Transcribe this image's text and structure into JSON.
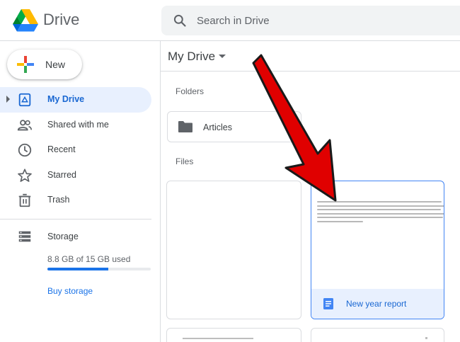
{
  "header": {
    "app_name": "Drive",
    "search_placeholder": "Search in Drive"
  },
  "sidebar": {
    "new_label": "New",
    "items": [
      {
        "label": "My Drive",
        "icon": "my-drive-icon",
        "active": true
      },
      {
        "label": "Shared with me",
        "icon": "shared-people-icon",
        "active": false
      },
      {
        "label": "Recent",
        "icon": "clock-icon",
        "active": false
      },
      {
        "label": "Starred",
        "icon": "star-icon",
        "active": false
      },
      {
        "label": "Trash",
        "icon": "trash-icon",
        "active": false
      }
    ],
    "storage": {
      "label": "Storage",
      "used_text": "8.8 GB of 15 GB used",
      "used_fraction": 0.587,
      "buy_label": "Buy storage"
    }
  },
  "main": {
    "title": "My Drive",
    "folders_label": "Folders",
    "folders": [
      {
        "name": "Articles",
        "icon": "folder-icon"
      }
    ],
    "files_label": "Files",
    "files": [
      {
        "name": "",
        "selected": false
      },
      {
        "name": "New year report",
        "icon": "google-docs-icon",
        "selected": true
      }
    ]
  },
  "colors": {
    "accent": "#1a73e8",
    "active_bg": "#e8f0fe",
    "arrow_red": "#e00000"
  }
}
